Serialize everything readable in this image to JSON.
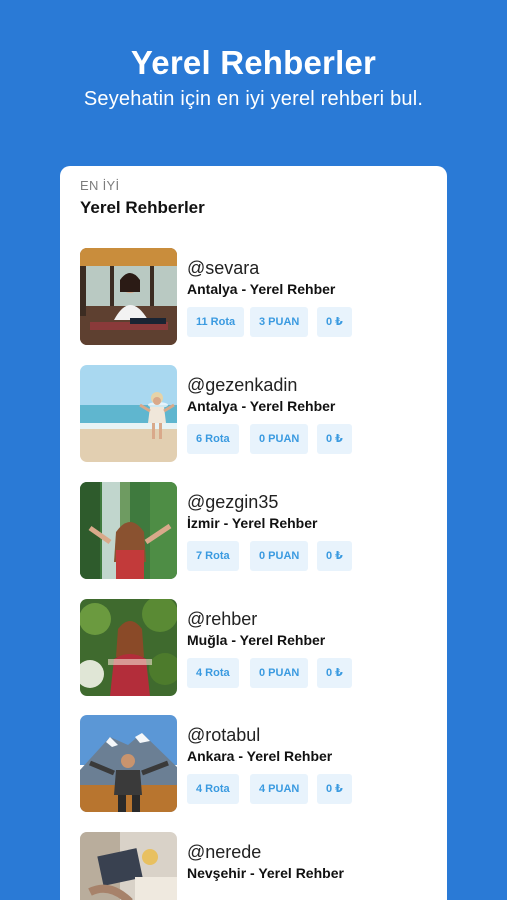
{
  "header": {
    "title": "Yerel Rehberler",
    "subtitle": "Seyehatin için en iyi yerel rehberi bul."
  },
  "section": {
    "kicker": "EN İYİ",
    "title": "Yerel Rehberler"
  },
  "guides": [
    {
      "handle": "@sevara",
      "location": "Antalya - Yerel Rehber",
      "routes": "11 Rota",
      "points": "3 PUAN",
      "price": "0 ₺"
    },
    {
      "handle": "@gezenkadin",
      "location": "Antalya - Yerel Rehber",
      "routes": "6 Rota",
      "points": "0 PUAN",
      "price": "0 ₺"
    },
    {
      "handle": "@gezgin35",
      "location": "İzmir - Yerel Rehber",
      "routes": "7 Rota",
      "points": "0 PUAN",
      "price": "0 ₺"
    },
    {
      "handle": "@rehber",
      "location": "Muğla - Yerel Rehber",
      "routes": "4 Rota",
      "points": "0 PUAN",
      "price": "0 ₺"
    },
    {
      "handle": "@rotabul",
      "location": "Ankara - Yerel Rehber",
      "routes": "4 Rota",
      "points": "4 PUAN",
      "price": "0 ₺"
    },
    {
      "handle": "@nerede",
      "location": "Nevşehir - Yerel Rehber",
      "routes": "",
      "points": "",
      "price": ""
    }
  ],
  "colors": {
    "background": "#2a7ad6",
    "chip_bg": "#e8f3fc",
    "chip_text": "#3a9ae0"
  }
}
